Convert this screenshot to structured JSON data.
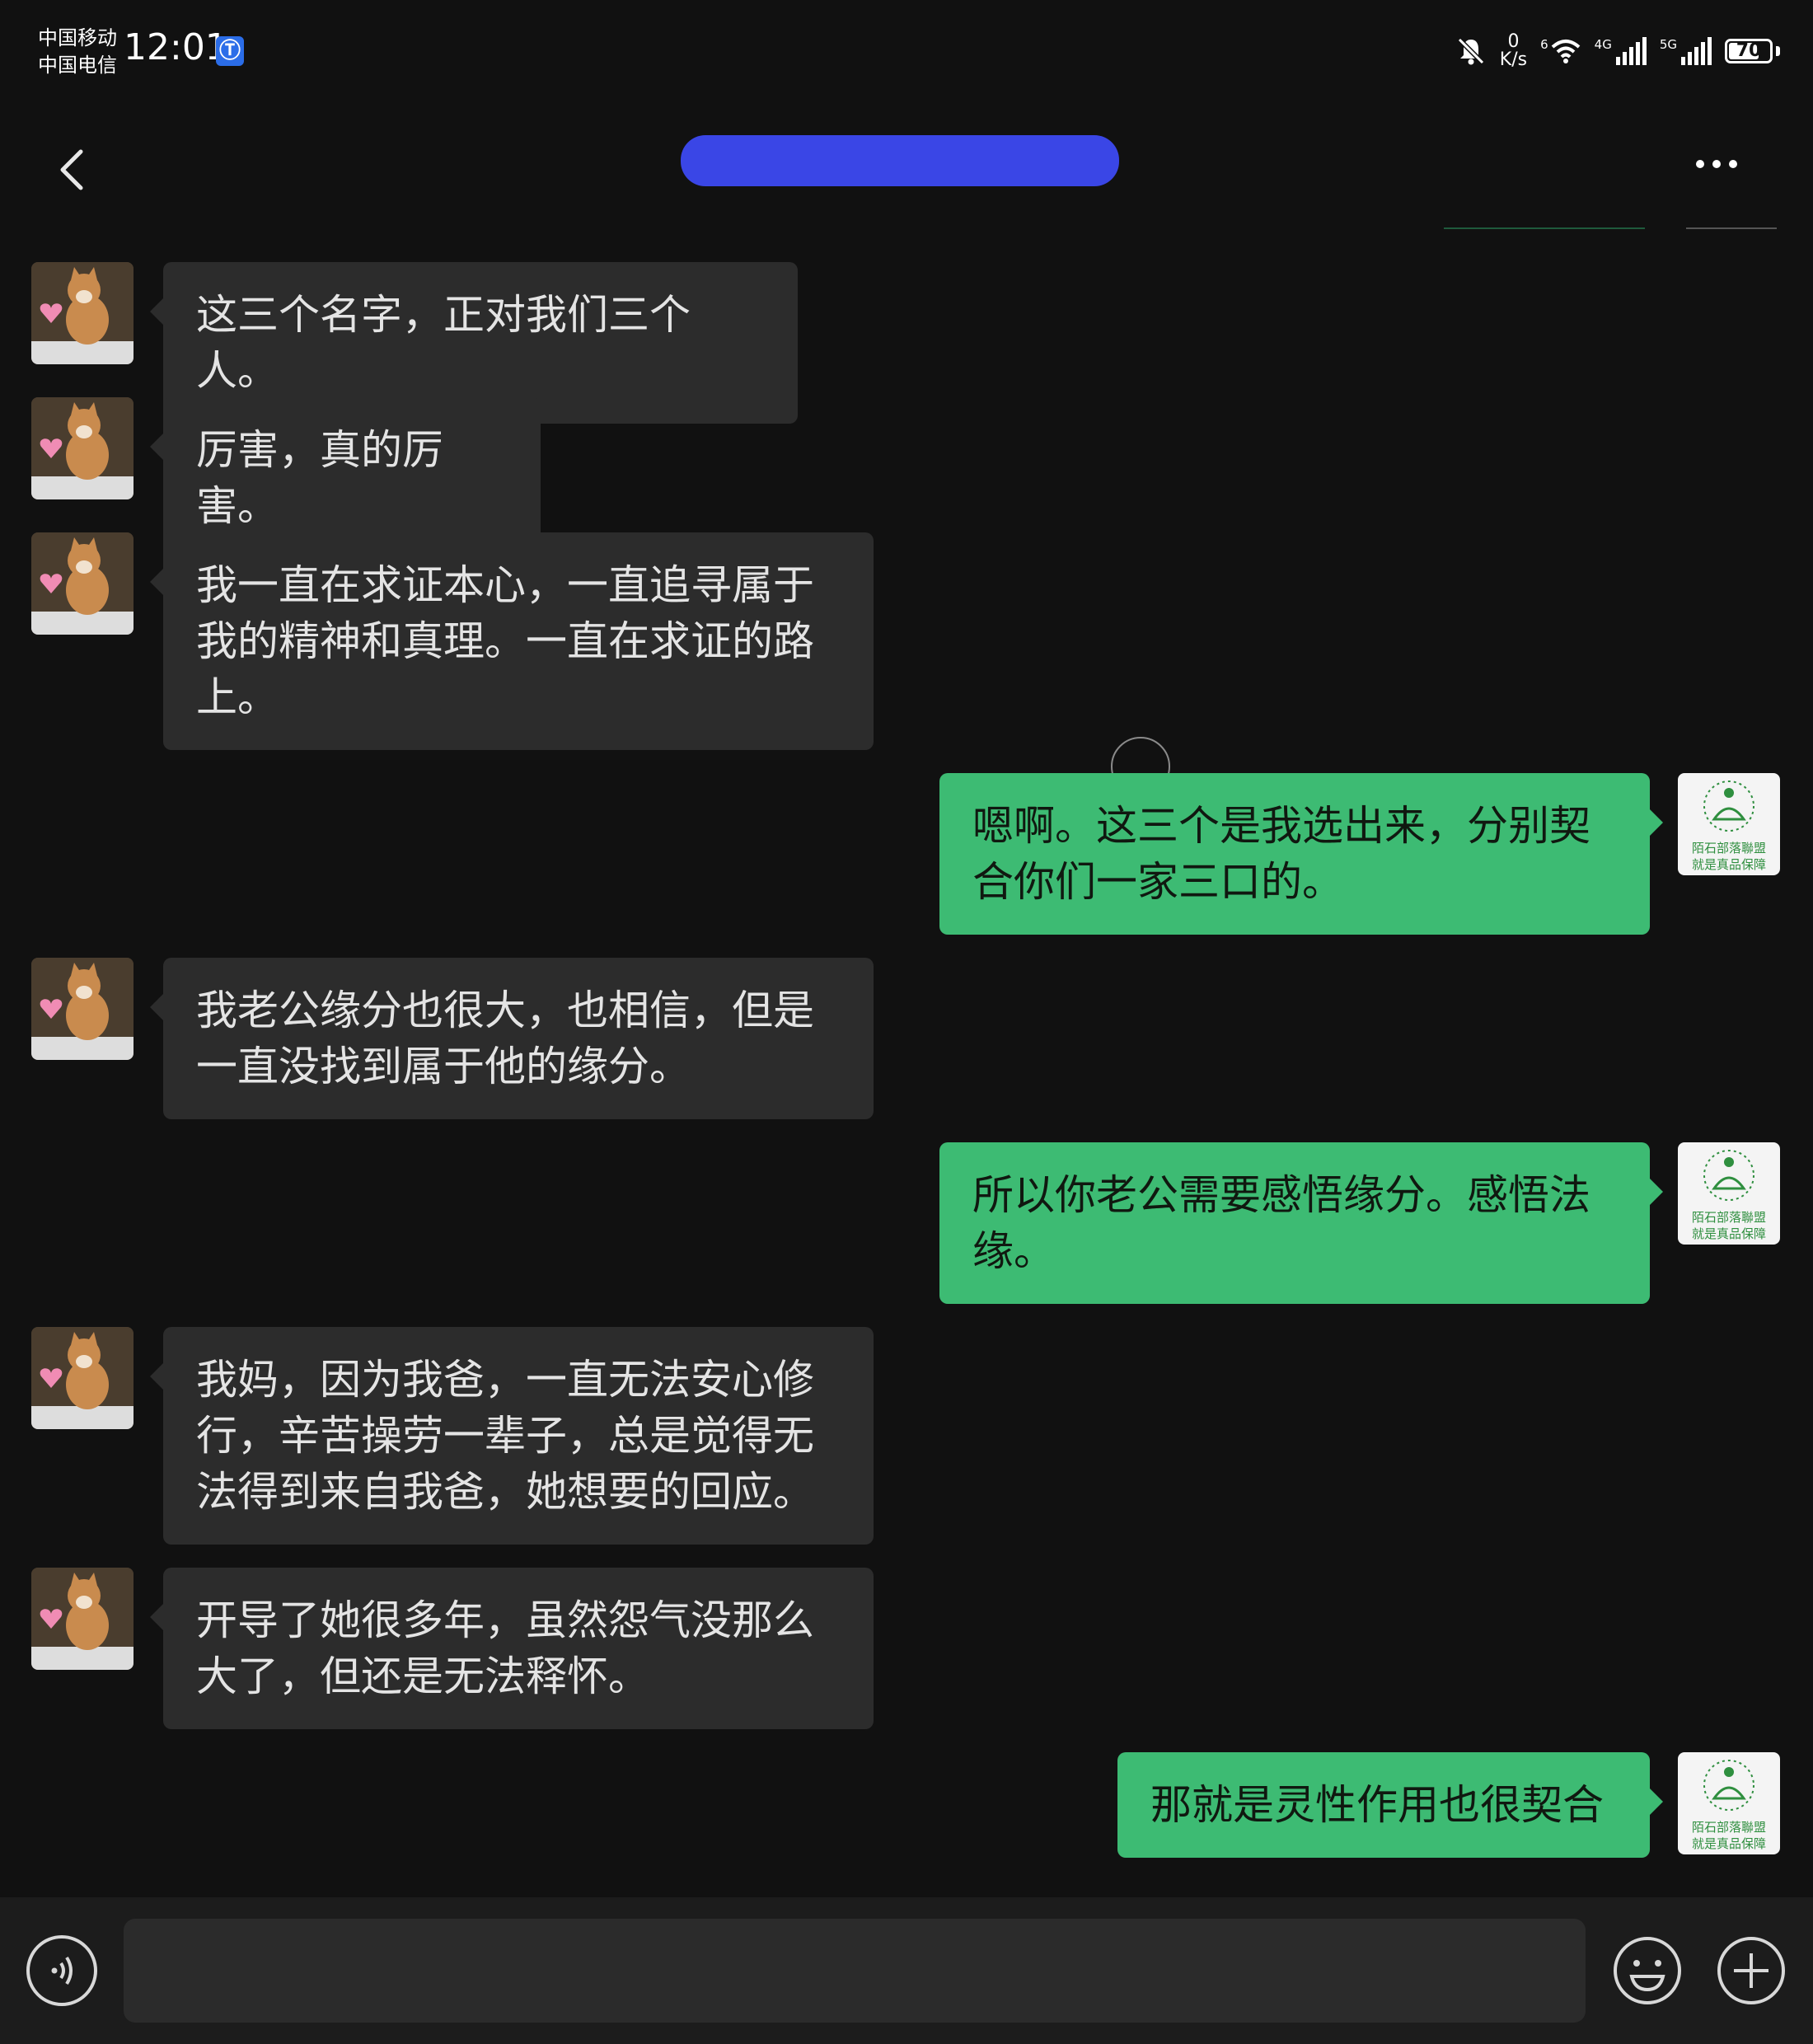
{
  "status_bar": {
    "carrier_1": "中国移动",
    "carrier_2": "中国电信",
    "time": "12:01",
    "net_speed_value": "0",
    "net_speed_unit": "K/s",
    "wifi_label": "6",
    "signal_1_label": "4G",
    "signal_2_label": "5G",
    "battery": "70"
  },
  "header": {
    "title": "",
    "title_redacted": true
  },
  "messages": [
    {
      "side": "in",
      "text": "这三个名字，正对我们三个人。"
    },
    {
      "side": "in",
      "text": "厉害，真的厉害。"
    },
    {
      "side": "in",
      "text": "我一直在求证本心，一直追寻属于我的精神和真理。一直在求证的路上。"
    },
    {
      "side": "out",
      "text": "嗯啊。这三个是我选出来，分别契合你们一家三口的。"
    },
    {
      "side": "in",
      "text": "我老公缘分也很大，也相信，但是一直没找到属于他的缘分。"
    },
    {
      "side": "out",
      "text": "所以你老公需要感悟缘分。感悟法缘。"
    },
    {
      "side": "in",
      "text": "我妈，因为我爸，一直无法安心修行，辛苦操劳一辈子，总是觉得无法得到来自我爸，她想要的回应。"
    },
    {
      "side": "in",
      "text": "开导了她很多年，虽然怨气没那么大了，但还是无法释怀。"
    },
    {
      "side": "out",
      "text": "那就是灵性作用也很契合"
    }
  ],
  "self_avatar": {
    "line1": "陌石部落聯盟",
    "line2": "就是真品保障"
  },
  "input_bar": {
    "placeholder": "",
    "value": ""
  },
  "colors": {
    "background": "#111111",
    "incoming_bubble": "#2c2c2c",
    "outgoing_bubble": "#3dbb73",
    "title_redaction": "#3a46e6"
  }
}
